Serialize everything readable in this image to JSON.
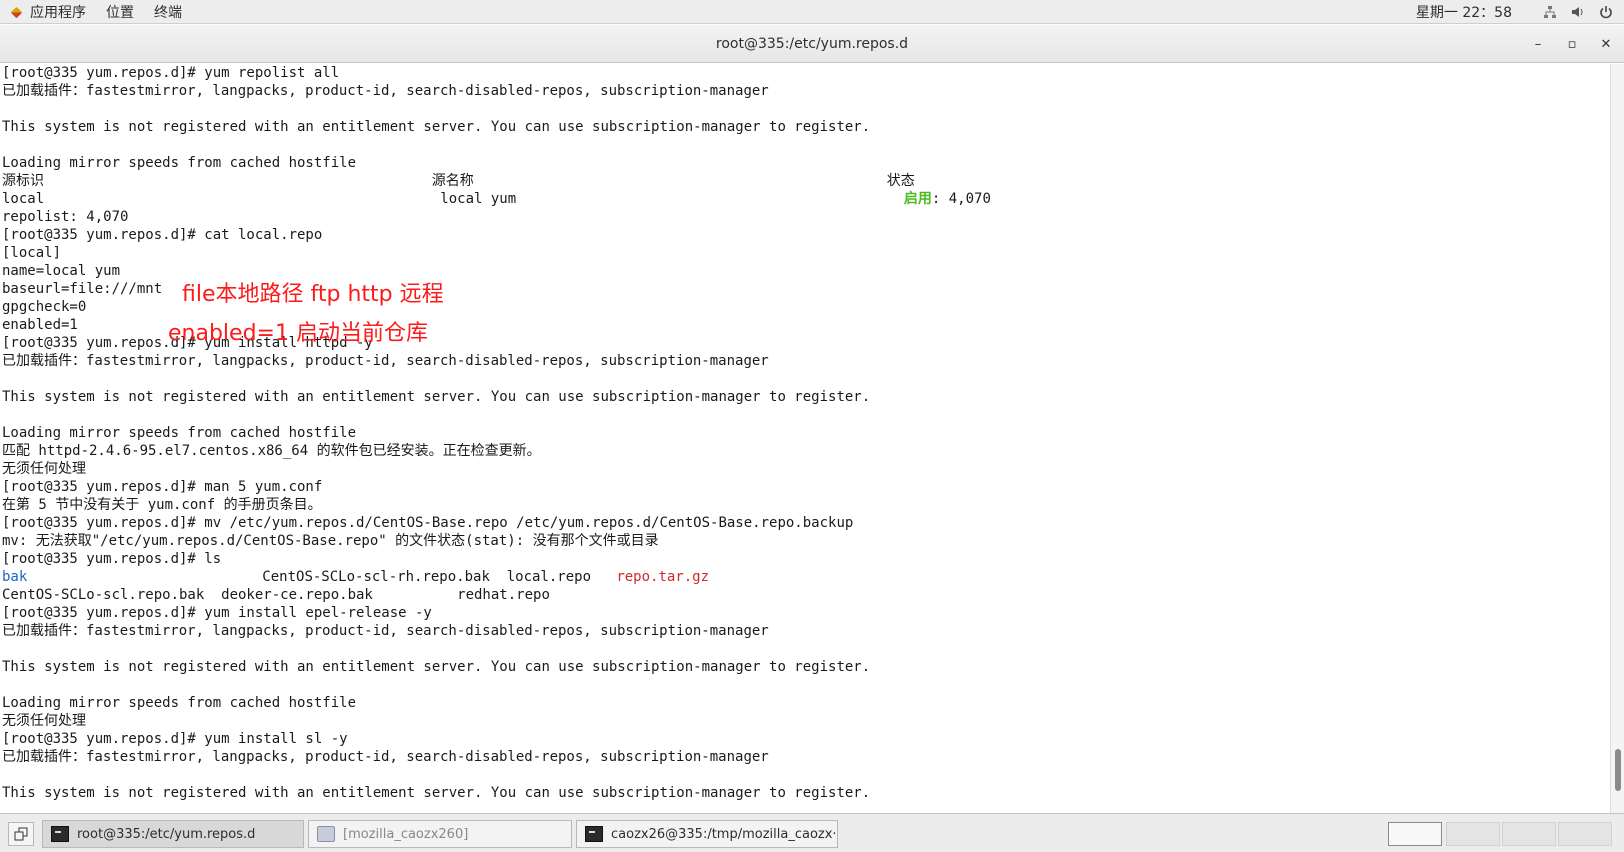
{
  "topbar": {
    "menus": [
      "应用程序",
      "位置",
      "终端"
    ],
    "clock": "星期一 22：58",
    "tray": [
      "network-icon",
      "volume-icon",
      "power-icon"
    ]
  },
  "window": {
    "title": "root@335:/etc/yum.repos.d",
    "minimize": "–",
    "maximize": "▫",
    "close": "✕"
  },
  "terminal": {
    "lines": [
      "[root@335 yum.repos.d]# yum repolist all",
      "已加载插件：fastestmirror, langpacks, product-id, search-disabled-repos, subscription-manager",
      "",
      "This system is not registered with an entitlement server. You can use subscription-manager to register.",
      "",
      "Loading mirror speeds from cached hostfile",
      "源标识                                              源名称                                                 状态",
      "local                                               local yum                                              ",
      "repolist: 4,070",
      "[root@335 yum.repos.d]# cat local.repo",
      "[local]",
      "name=local yum",
      "baseurl=file:///mnt",
      "gpgcheck=0",
      "enabled=1",
      "[root@335 yum.repos.d]# yum install httpd -y",
      "已加载插件：fastestmirror, langpacks, product-id, search-disabled-repos, subscription-manager",
      "",
      "This system is not registered with an entitlement server. You can use subscription-manager to register.",
      "",
      "Loading mirror speeds from cached hostfile",
      "匹配 httpd-2.4.6-95.el7.centos.x86_64 的软件包已经安装。正在检查更新。",
      "无须任何处理",
      "[root@335 yum.repos.d]# man 5 yum.conf",
      "在第 5 节中没有关于 yum.conf 的手册页条目。",
      "[root@335 yum.repos.d]# mv /etc/yum.repos.d/CentOS-Base.repo /etc/yum.repos.d/CentOS-Base.repo.backup",
      "mv: 无法获取\"/etc/yum.repos.d/CentOS-Base.repo\" 的文件状态(stat): 没有那个文件或目录",
      "[root@335 yum.repos.d]# ls",
      "",
      "CentOS-SCLo-scl.repo.bak  deoker-ce.repo.bak          redhat.repo",
      "[root@335 yum.repos.d]# yum install epel-release -y",
      "已加载插件：fastestmirror, langpacks, product-id, search-disabled-repos, subscription-manager",
      "",
      "This system is not registered with an entitlement server. You can use subscription-manager to register.",
      "",
      "Loading mirror speeds from cached hostfile",
      "无须任何处理",
      "[root@335 yum.repos.d]# yum install sl -y",
      "已加载插件：fastestmirror, langpacks, product-id, search-disabled-repos, subscription-manager",
      "",
      "This system is not registered with an entitlement server. You can use subscription-manager to register."
    ],
    "repo_status_enabled": "启用",
    "repo_status_count": ": 4,070",
    "ls_row1": {
      "bak": "bak",
      "col2": "CentOS-SCLo-scl-rh.repo.bak  local.repo   ",
      "tar": "repo.tar.gz"
    }
  },
  "annotations": {
    "baseurl_note": "file本地路径 ftp http 远程",
    "enabled_note": "enabled=1 启动当前仓库"
  },
  "taskbar": {
    "tasks": [
      {
        "label": "root@335:/etc/yum.repos.d"
      },
      {
        "label": "[mozilla_caozx260]"
      },
      {
        "label": "caozx26@335:/tmp/mozilla_caozx···"
      }
    ]
  },
  "colors": {
    "enabled_green": "#4dbb1f",
    "directory_blue": "#1b66c9",
    "archive_red": "#d02a2a",
    "annotation_red": "#ff1a1a"
  }
}
